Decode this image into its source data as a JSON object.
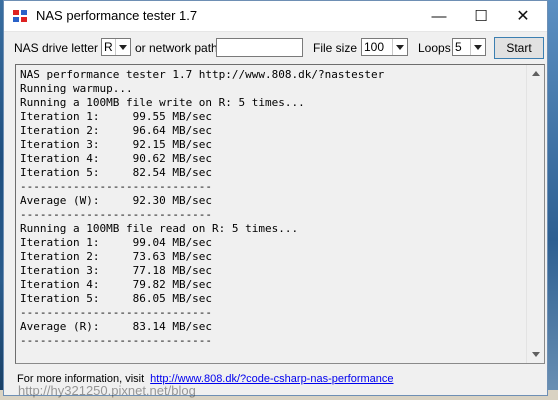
{
  "window": {
    "title": "NAS performance tester 1.7",
    "minimize_glyph": "—",
    "maximize_glyph": "☐",
    "close_glyph": "✕"
  },
  "toolbar": {
    "drive_label": "NAS drive letter",
    "drive_value": "R",
    "network_label": "or network path",
    "network_value": "",
    "filesize_label": "File size",
    "filesize_value": "100",
    "loops_label": "Loops",
    "loops_value": "5",
    "start_label": "Start"
  },
  "console": {
    "lines": [
      "NAS performance tester 1.7 http://www.808.dk/?nastester",
      "Running warmup...",
      "Running a 100MB file write on R: 5 times...",
      "Iteration 1:     99.55 MB/sec",
      "Iteration 2:     96.64 MB/sec",
      "Iteration 3:     92.15 MB/sec",
      "Iteration 4:     90.62 MB/sec",
      "Iteration 5:     82.54 MB/sec",
      "-----------------------------",
      "Average (W):     92.30 MB/sec",
      "-----------------------------",
      "Running a 100MB file read on R: 5 times...",
      "Iteration 1:     99.04 MB/sec",
      "Iteration 2:     73.63 MB/sec",
      "Iteration 3:     77.18 MB/sec",
      "Iteration 4:     79.82 MB/sec",
      "Iteration 5:     86.05 MB/sec",
      "-----------------------------",
      "Average (R):     83.14 MB/sec",
      "-----------------------------"
    ]
  },
  "footer": {
    "text": "For more information, visit",
    "link": "http://www.808.dk/?code-csharp-nas-performance"
  },
  "watermark": "http://hy321250.pixnet.net/blog",
  "icons": {
    "app": "app-icon",
    "dropdown": "chevron-down-icon"
  }
}
